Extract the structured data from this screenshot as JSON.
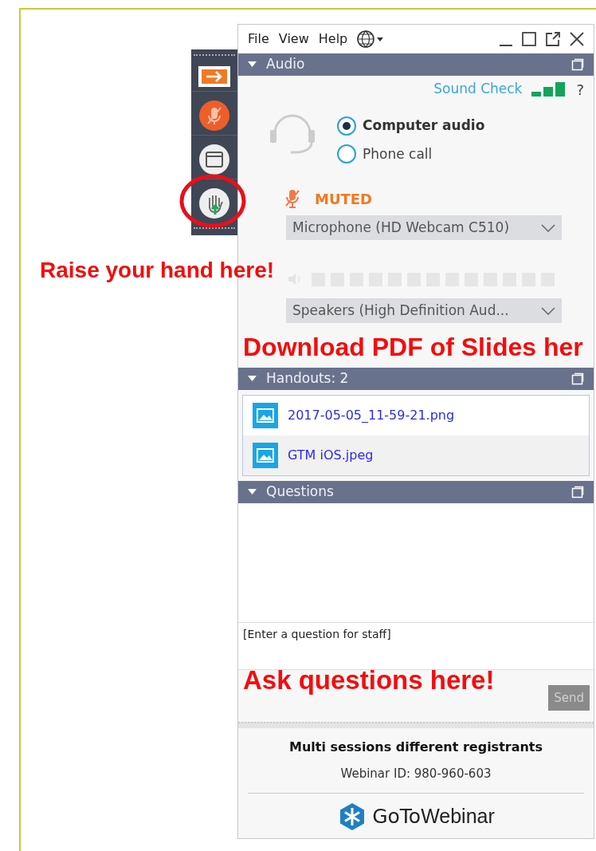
{
  "menu": [
    "File",
    "View",
    "Help"
  ],
  "side_toolbar": [
    {
      "kind": "exit",
      "highlighted": false
    },
    {
      "kind": "mic",
      "highlighted": false
    },
    {
      "kind": "screen",
      "highlighted": false
    },
    {
      "kind": "hand",
      "highlighted": true
    }
  ],
  "audio": {
    "title": "Audio",
    "sound_check": "Sound Check",
    "help": "?",
    "options": [
      {
        "label": "Computer audio",
        "selected": true
      },
      {
        "label": "Phone call",
        "selected": false
      }
    ],
    "mute_status": "MUTED",
    "microphone": "Microphone (HD Webcam C510)",
    "speakers": "Speakers (High  Definition  Aud..."
  },
  "handouts": {
    "title": "Handouts: 2",
    "files": [
      {
        "name": "2017-05-05_11-59-21.png",
        "highlighted": false
      },
      {
        "name": "GTM iOS.jpeg",
        "highlighted": true
      }
    ]
  },
  "questions": {
    "title": "Questions",
    "placeholder": "[Enter a question for staff]",
    "send": "Send",
    "send_disabled": true
  },
  "footer": {
    "title": "Multi sessions different registrants",
    "webinar_id": "Webinar ID: 980-960-603",
    "logo_text": [
      "GoTo",
      "Webinar"
    ]
  },
  "annotations": [
    {
      "kind": "hand",
      "text": "Raise your hand here!"
    },
    {
      "kind": "handouts",
      "text": "Download PDF of Slides her"
    },
    {
      "kind": "questions",
      "text": "Ask questions here!"
    }
  ]
}
